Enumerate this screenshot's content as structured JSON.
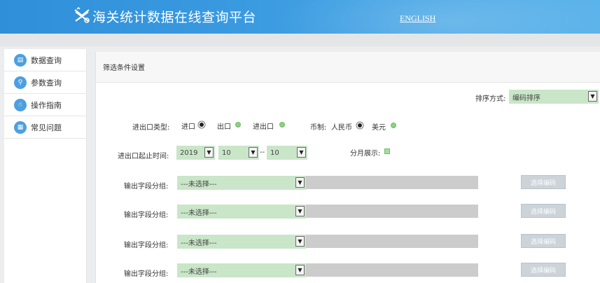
{
  "header": {
    "title": "海关统计数据在线查询平台",
    "english_link": "ENGLISH"
  },
  "sidebar": {
    "items": [
      {
        "label": "数据查询",
        "icon": "search-doc-icon"
      },
      {
        "label": "参数查询",
        "icon": "magnifier-icon"
      },
      {
        "label": "操作指南",
        "icon": "hand-icon"
      },
      {
        "label": "常见问题",
        "icon": "document-icon"
      }
    ]
  },
  "main": {
    "panel_title": "筛选条件设置",
    "sort": {
      "label": "排序方式:",
      "value": "编码排序"
    },
    "trade_type": {
      "label": "进出口类型:",
      "options": [
        {
          "label": "进口",
          "selected": true
        },
        {
          "label": "出口",
          "selected": false
        },
        {
          "label": "进出口",
          "selected": false
        }
      ]
    },
    "currency": {
      "label": "币制:",
      "options": [
        {
          "label": "人民币",
          "selected": true
        },
        {
          "label": "美元",
          "selected": false
        }
      ]
    },
    "period": {
      "label": "进出口起止时间:",
      "year": "2019",
      "start_month": "10",
      "separator": "--",
      "end_month": "10"
    },
    "monthly": {
      "label": "分月展示:",
      "checked": false
    },
    "output_groups": [
      {
        "label": "输出字段分组:",
        "value": "---未选择---",
        "button": "选择编码"
      },
      {
        "label": "输出字段分组:",
        "value": "---未选择---",
        "button": "选择编码"
      },
      {
        "label": "输出字段分组:",
        "value": "---未选择---",
        "button": "选择编码"
      },
      {
        "label": "输出字段分组:",
        "value": "---未选择---",
        "button": "选择编码"
      }
    ]
  },
  "colors": {
    "header_blue": "#3a9ae0",
    "select_green": "#c9e6c8",
    "icon_blue": "#4d9fe0"
  }
}
